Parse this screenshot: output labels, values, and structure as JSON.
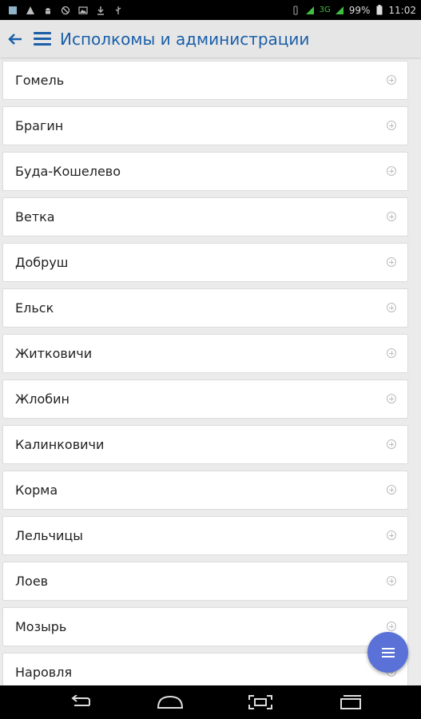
{
  "status_bar": {
    "battery": "99%",
    "time": "11:02",
    "network": "3G",
    "left_icons": [
      "notification-icon",
      "warning-icon",
      "android-icon",
      "blocked-icon",
      "image-icon",
      "download-icon",
      "usb-icon"
    ]
  },
  "app_bar": {
    "title": "Исполкомы и администрации"
  },
  "list": {
    "items": [
      {
        "label": "Гомель"
      },
      {
        "label": "Брагин"
      },
      {
        "label": "Буда-Кошелево"
      },
      {
        "label": "Ветка"
      },
      {
        "label": "Добруш"
      },
      {
        "label": "Ельск"
      },
      {
        "label": "Житковичи"
      },
      {
        "label": "Жлобин"
      },
      {
        "label": "Калинковичи"
      },
      {
        "label": "Корма"
      },
      {
        "label": "Лельчицы"
      },
      {
        "label": "Лоев"
      },
      {
        "label": "Мозырь"
      },
      {
        "label": "Наровля"
      }
    ]
  },
  "colors": {
    "accent": "#1a5fa8",
    "fab": "#5a72d8",
    "app_bar_bg": "#e6e6e6"
  }
}
